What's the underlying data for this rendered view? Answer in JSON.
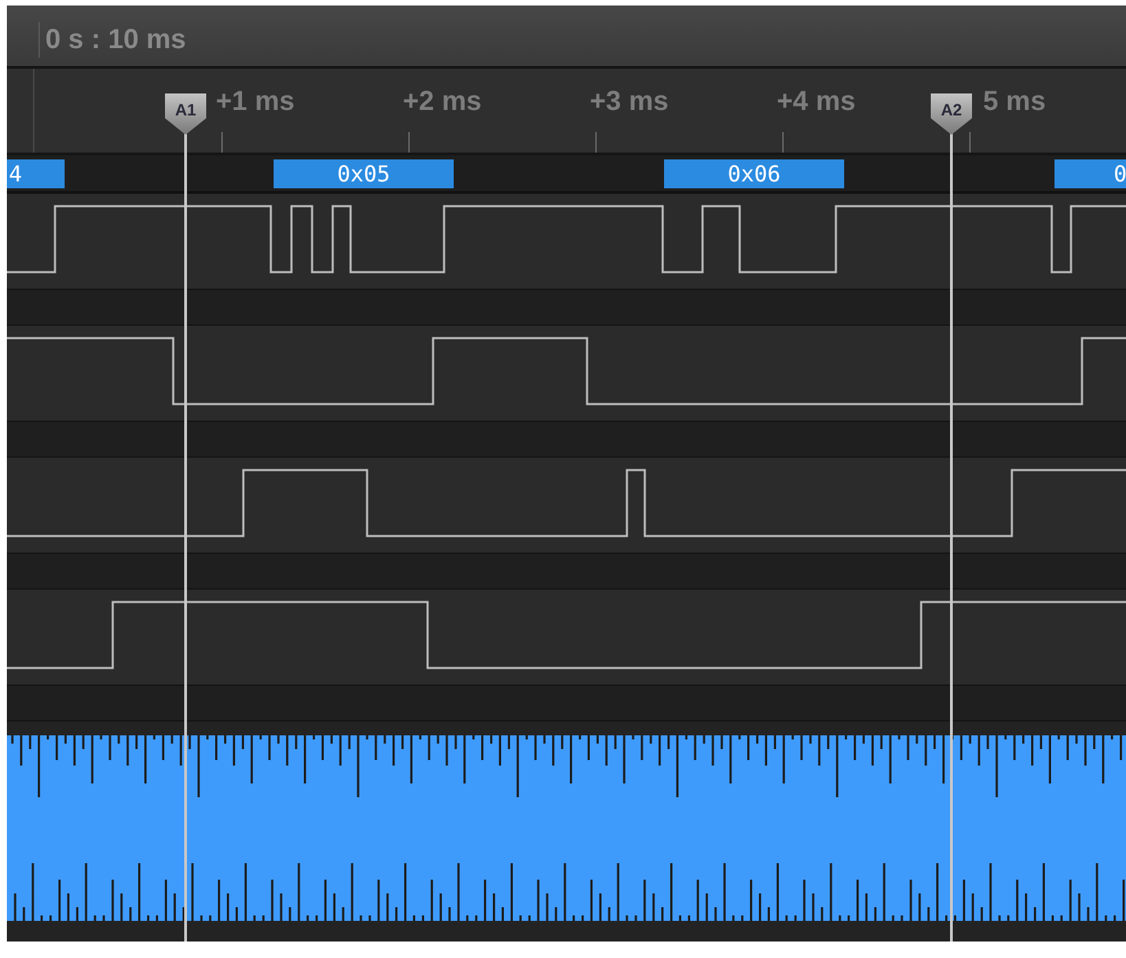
{
  "time_header": "0 s : 10 ms",
  "ruler_ticks": [
    {
      "label": "+1 ms"
    },
    {
      "label": "+2 ms"
    },
    {
      "label": "+3 ms"
    },
    {
      "label": "+4 ms"
    },
    {
      "label": "5 ms"
    }
  ],
  "decoded_values": [
    {
      "label": "4"
    },
    {
      "label": "0x05"
    },
    {
      "label": "0x06"
    },
    {
      "label": "0"
    }
  ],
  "cursors": [
    {
      "label": "A1"
    },
    {
      "label": "A2"
    }
  ],
  "channels": [
    {
      "kind": "digital"
    },
    {
      "kind": "digital"
    },
    {
      "kind": "digital"
    },
    {
      "kind": "digital"
    },
    {
      "kind": "analog"
    }
  ]
}
